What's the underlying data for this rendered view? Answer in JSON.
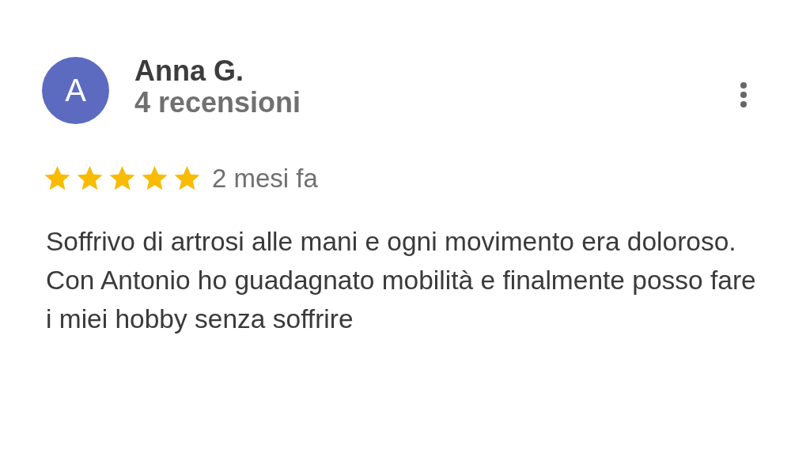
{
  "review": {
    "avatar_letter": "A",
    "author": "Anna G.",
    "review_count": "4 recensioni",
    "stars": 5,
    "time": "2 mesi fa",
    "text_lines": [
      "Soffrivo di artrosi alle mani e ogni movimento era doloroso.",
      "Con Antonio ho guadagnato mobilità e finalmente posso fare",
      "i miei hobby senza soffrire"
    ]
  }
}
